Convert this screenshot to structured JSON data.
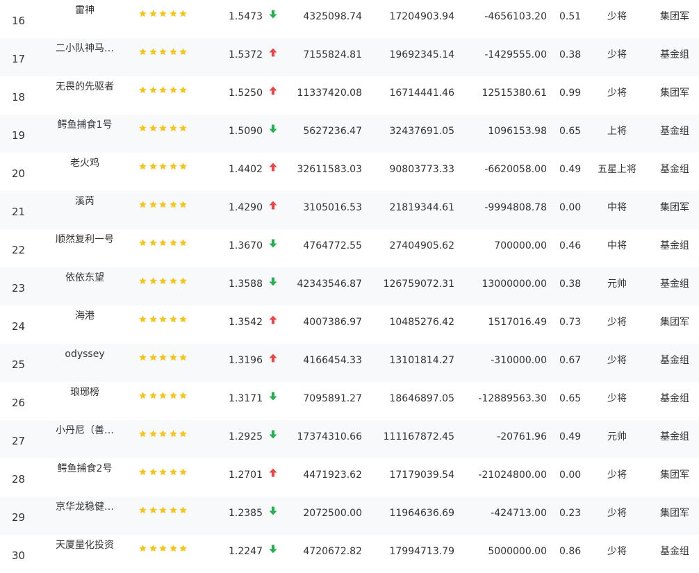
{
  "colors": {
    "star": "#f5c51d",
    "up": "#ef4444",
    "down": "#22b14c",
    "text": "#333333",
    "stripe": "#f8f9fb"
  },
  "main": {
    "rows": [
      {
        "rank": "16",
        "name": "雷神",
        "rating": 5,
        "nav": "1.5473",
        "trend": "down",
        "total_assets": "4325098.74",
        "amount": "17204903.94",
        "net_flow": "-4656103.20",
        "score": "0.51",
        "level": "少将",
        "group": "集团军"
      },
      {
        "rank": "17",
        "name": "二小队神马…",
        "rating": 5,
        "nav": "1.5372",
        "trend": "up",
        "total_assets": "7155824.81",
        "amount": "19692345.14",
        "net_flow": "-1429555.00",
        "score": "0.38",
        "level": "少将",
        "group": "基金组"
      },
      {
        "rank": "18",
        "name": "无畏的先驱者",
        "rating": 5,
        "nav": "1.5250",
        "trend": "up",
        "total_assets": "11337420.08",
        "amount": "16714441.46",
        "net_flow": "12515380.61",
        "score": "0.99",
        "level": "少将",
        "group": "集团军"
      },
      {
        "rank": "19",
        "name": "鳄鱼捕食1号",
        "rating": 5,
        "nav": "1.5090",
        "trend": "down",
        "total_assets": "5627236.47",
        "amount": "32437691.05",
        "net_flow": "1096153.98",
        "score": "0.65",
        "level": "上将",
        "group": "基金组"
      },
      {
        "rank": "20",
        "name": "老火鸡",
        "rating": 5,
        "nav": "1.4402",
        "trend": "up",
        "total_assets": "32611583.03",
        "amount": "90803773.33",
        "net_flow": "-6620058.00",
        "score": "0.49",
        "level": "五星上将",
        "group": "基金组"
      },
      {
        "rank": "21",
        "name": "溪芮",
        "rating": 5,
        "nav": "1.4290",
        "trend": "up",
        "total_assets": "3105016.53",
        "amount": "21819344.61",
        "net_flow": "-9994808.78",
        "score": "0.00",
        "level": "中将",
        "group": "集团军"
      },
      {
        "rank": "22",
        "name": "顺然复利一号",
        "rating": 5,
        "nav": "1.3670",
        "trend": "down",
        "total_assets": "4764772.55",
        "amount": "27404905.62",
        "net_flow": "700000.00",
        "score": "0.46",
        "level": "中将",
        "group": "基金组"
      },
      {
        "rank": "23",
        "name": "依依东望",
        "rating": 5,
        "nav": "1.3588",
        "trend": "down",
        "total_assets": "42343546.87",
        "amount": "126759072.31",
        "net_flow": "13000000.00",
        "score": "0.38",
        "level": "元帅",
        "group": "基金组"
      },
      {
        "rank": "24",
        "name": "海港",
        "rating": 5,
        "nav": "1.3542",
        "trend": "up",
        "total_assets": "4007386.97",
        "amount": "10485276.42",
        "net_flow": "1517016.49",
        "score": "0.73",
        "level": "少将",
        "group": "集团军"
      },
      {
        "rank": "25",
        "name": "odyssey",
        "rating": 5,
        "nav": "1.3196",
        "trend": "up",
        "total_assets": "4166454.33",
        "amount": "13101814.27",
        "net_flow": "-310000.00",
        "score": "0.67",
        "level": "少将",
        "group": "基金组"
      },
      {
        "rank": "26",
        "name": "琅琊榜",
        "rating": 5,
        "nav": "1.3171",
        "trend": "down",
        "total_assets": "7095891.27",
        "amount": "18646897.05",
        "net_flow": "-12889563.30",
        "score": "0.65",
        "level": "少将",
        "group": "基金组"
      },
      {
        "rank": "27",
        "name": "小丹尼（善…",
        "rating": 5,
        "nav": "1.2925",
        "trend": "down",
        "total_assets": "17374310.66",
        "amount": "111167872.45",
        "net_flow": "-20761.96",
        "score": "0.49",
        "level": "元帅",
        "group": "基金组"
      },
      {
        "rank": "28",
        "name": "鳄鱼捕食2号",
        "rating": 5,
        "nav": "1.2701",
        "trend": "up",
        "total_assets": "4471923.62",
        "amount": "17179039.54",
        "net_flow": "-21024800.00",
        "score": "0.00",
        "level": "少将",
        "group": "集团军"
      },
      {
        "rank": "29",
        "name": "京华龙稳健…",
        "rating": 5,
        "nav": "1.2385",
        "trend": "down",
        "total_assets": "2072500.00",
        "amount": "11964636.69",
        "net_flow": "-424713.00",
        "score": "0.23",
        "level": "少将",
        "group": "集团军"
      },
      {
        "rank": "30",
        "name": "天厦量化投资",
        "rating": 5,
        "nav": "1.2247",
        "trend": "down",
        "total_assets": "4720672.82",
        "amount": "17994713.79",
        "net_flow": "5000000.00",
        "score": "0.86",
        "level": "少将",
        "group": "基金组"
      }
    ]
  }
}
